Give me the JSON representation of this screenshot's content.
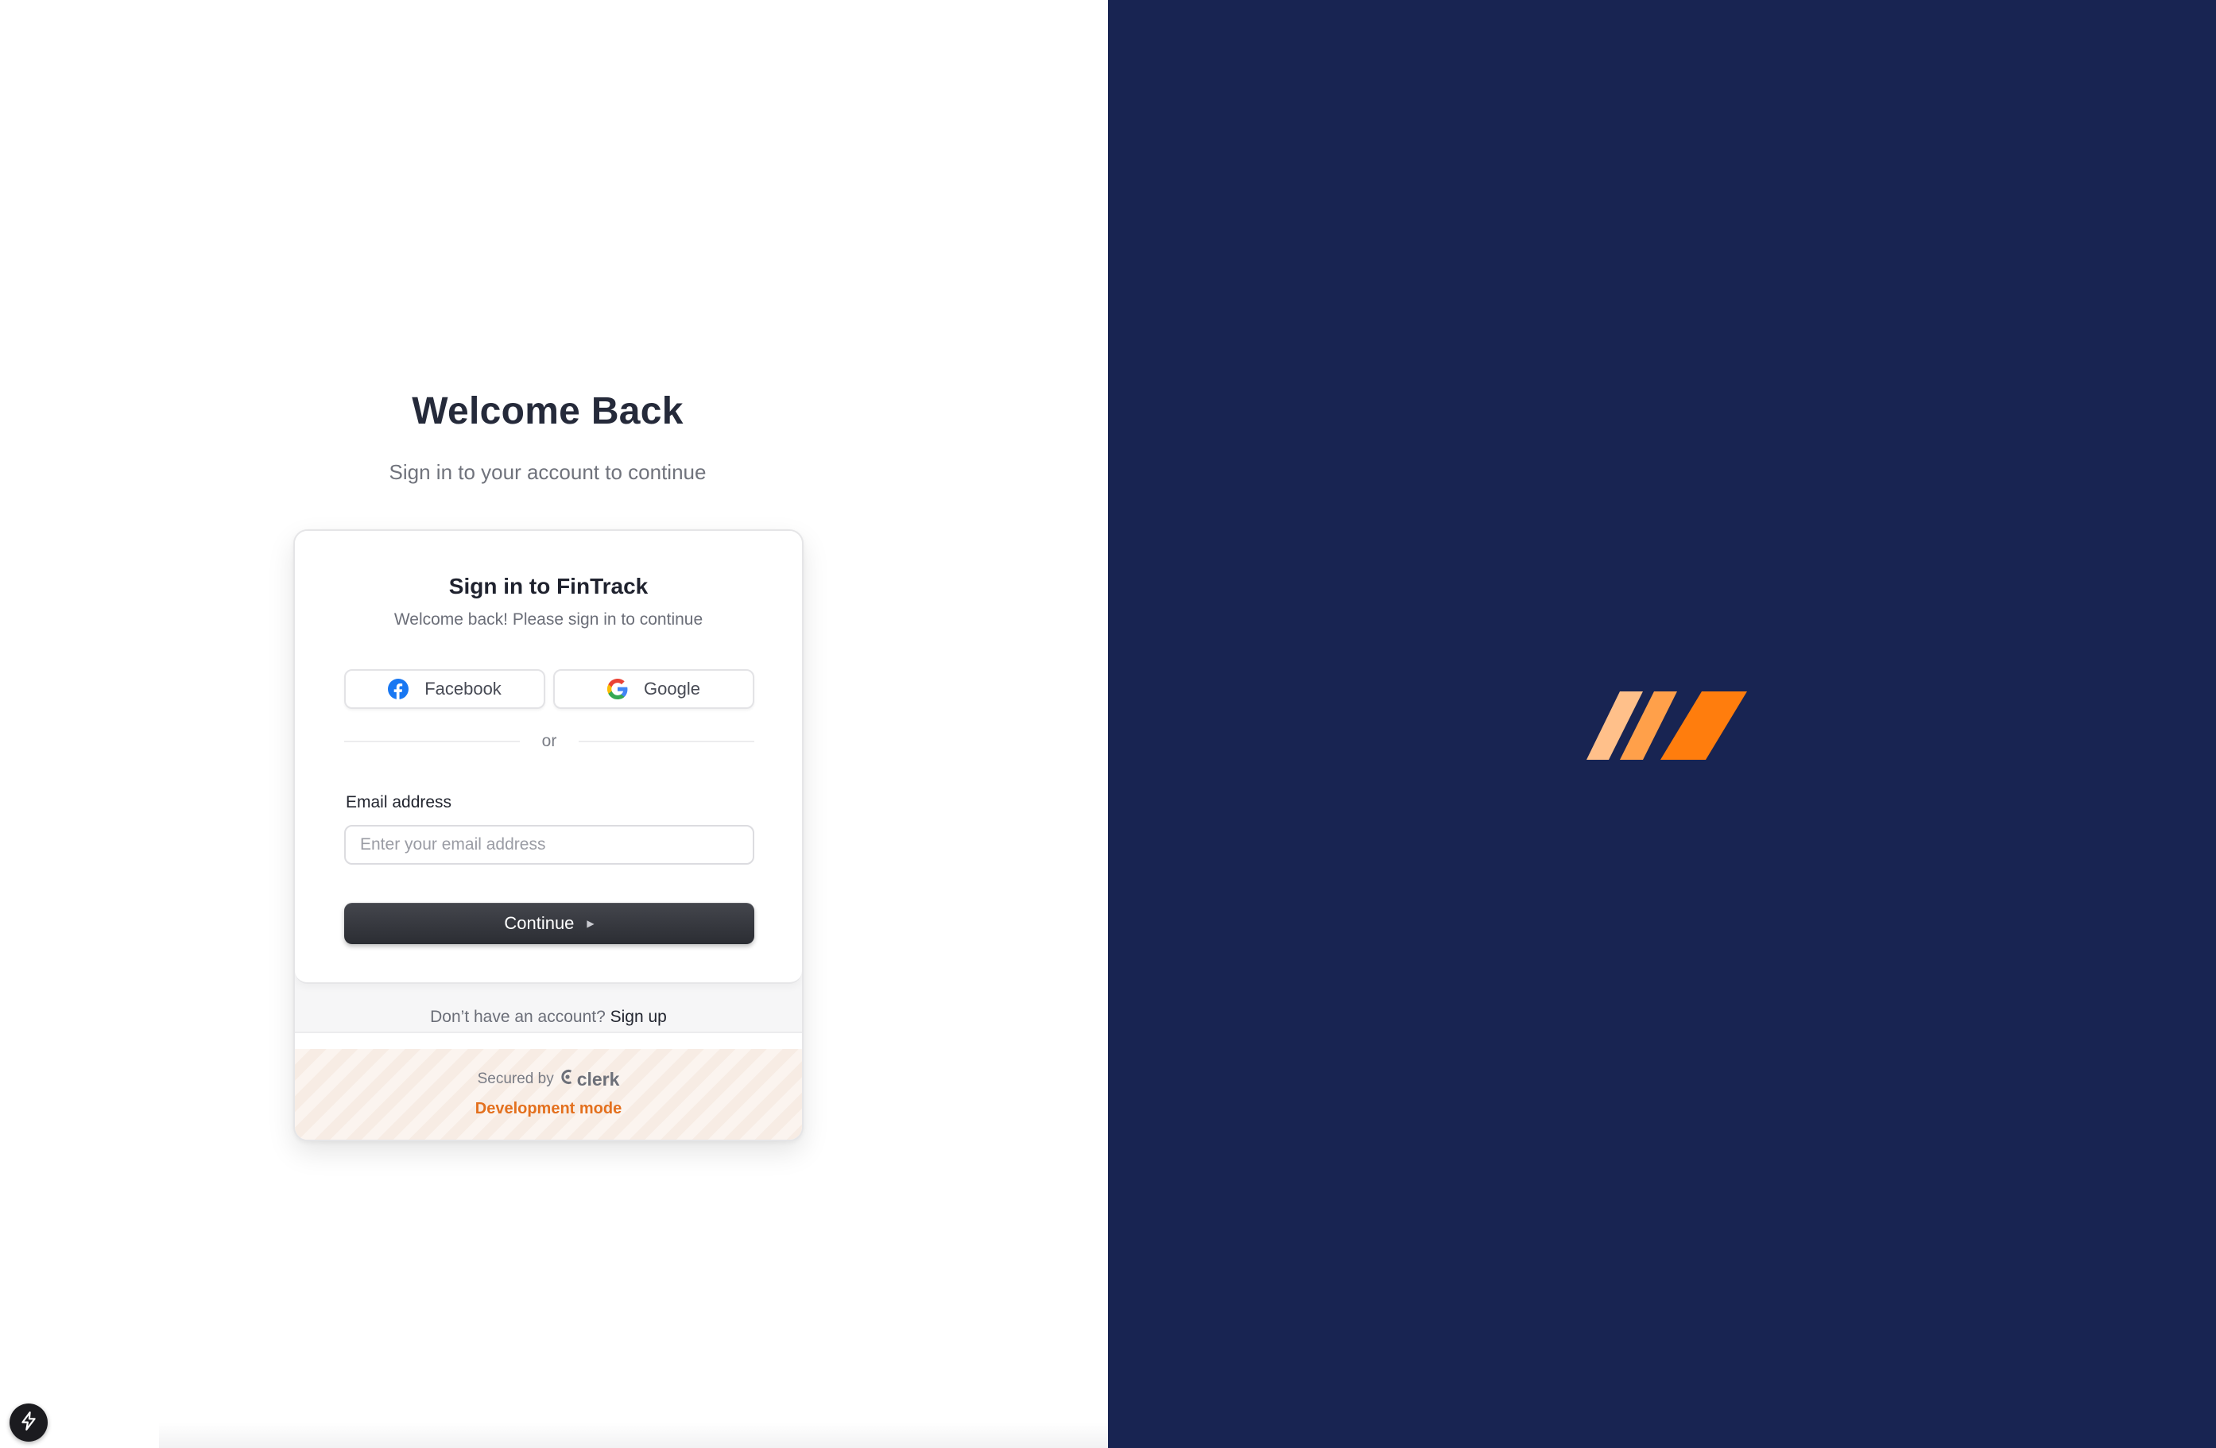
{
  "left": {
    "heading": "Welcome Back",
    "subheading": "Sign in to your account to continue"
  },
  "card": {
    "title": "Sign in to FinTrack",
    "subtitle": "Welcome back! Please sign in to continue",
    "social": {
      "facebook_label": "Facebook",
      "google_label": "Google"
    },
    "divider_text": "or",
    "email": {
      "label": "Email address",
      "placeholder": "Enter your email address",
      "value": ""
    },
    "continue_label": "Continue",
    "signup": {
      "prompt": "Don’t have an account?",
      "link": "Sign up"
    },
    "footer": {
      "secured_by": "Secured by",
      "provider": "clerk",
      "dev_mode": "Development mode"
    }
  },
  "colors": {
    "brand_panel": "#182452",
    "accent_orange": "#ff7d0d",
    "dev_mode": "#e3701e",
    "button_dark": "#2b2d33"
  },
  "icons": [
    "facebook-icon",
    "google-icon",
    "caret-right-icon",
    "clerk-logo-icon",
    "bolt-icon",
    "brand-stripes-logo"
  ]
}
